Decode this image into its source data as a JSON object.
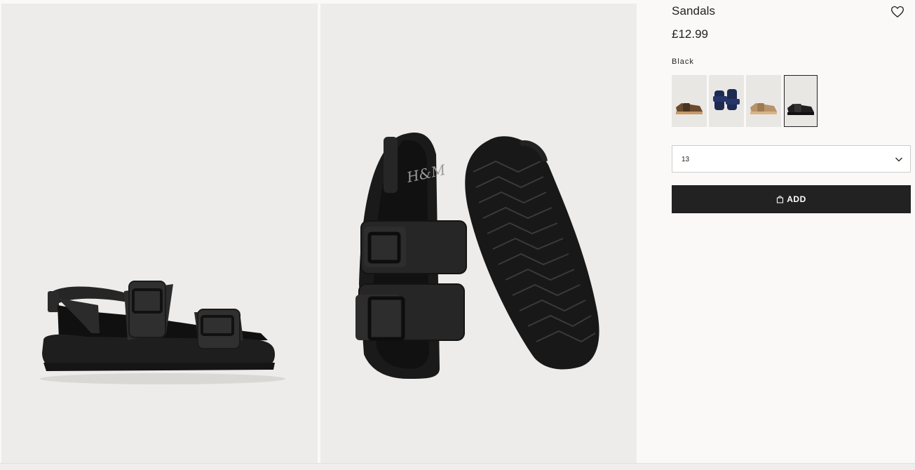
{
  "product": {
    "title": "Sandals",
    "price": "£12.99",
    "color_name": "Black",
    "swatches": [
      {
        "name": "brown",
        "color": "#6b4a2e"
      },
      {
        "name": "navy",
        "color": "#1d2a52"
      },
      {
        "name": "beige",
        "color": "#b8936a"
      },
      {
        "name": "black",
        "color": "#1f1f1f",
        "selected": true
      }
    ],
    "size": {
      "selected": "13"
    },
    "add_button_label": "ADD"
  },
  "images": [
    {
      "alt": "Black sandal side view"
    },
    {
      "alt": "Black sandals top and sole view"
    }
  ],
  "icons": {
    "favorite": "heart-outline-icon",
    "dropdown": "chevron-down-icon",
    "bag": "shopping-bag-icon"
  },
  "colors": {
    "accent": "#222222",
    "image_bg": "#edecea",
    "page_bg": "#faf9f8"
  }
}
